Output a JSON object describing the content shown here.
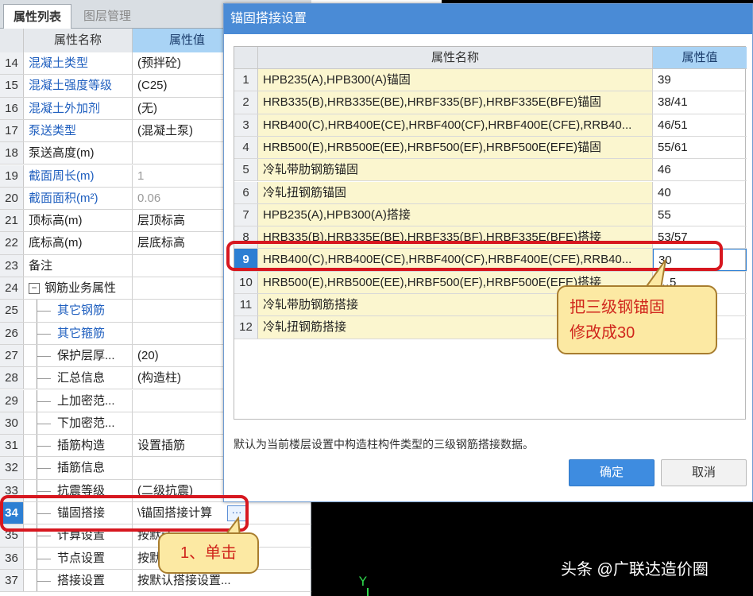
{
  "left_panel": {
    "tabs": [
      "属性列表",
      "图层管理"
    ],
    "header": {
      "name": "属性名称",
      "value": "属性值"
    },
    "rows": [
      {
        "num": "14",
        "name": "混凝土类型",
        "value": "(预拌砼)"
      },
      {
        "num": "15",
        "name": "混凝土强度等级",
        "value": "(C25)"
      },
      {
        "num": "16",
        "name": "混凝土外加剂",
        "value": "(无)"
      },
      {
        "num": "17",
        "name": "泵送类型",
        "value": "(混凝土泵)"
      },
      {
        "num": "18",
        "name": "泵送高度(m)",
        "value": ""
      },
      {
        "num": "19",
        "name": "截面周长(m)",
        "value": "1"
      },
      {
        "num": "20",
        "name": "截面面积(m²)",
        "value": "0.06"
      },
      {
        "num": "21",
        "name": "顶标高(m)",
        "value": "层顶标高"
      },
      {
        "num": "22",
        "name": "底标高(m)",
        "value": "层底标高"
      },
      {
        "num": "23",
        "name": "备注",
        "value": ""
      },
      {
        "num": "24",
        "name": "钢筋业务属性",
        "value": "",
        "collapse": "−"
      },
      {
        "num": "25",
        "name": "其它钢筋",
        "value": ""
      },
      {
        "num": "26",
        "name": "其它箍筋",
        "value": ""
      },
      {
        "num": "27",
        "name": "保护层厚...",
        "value": "(20)"
      },
      {
        "num": "28",
        "name": "汇总信息",
        "value": "(构造柱)"
      },
      {
        "num": "29",
        "name": "上加密范...",
        "value": ""
      },
      {
        "num": "30",
        "name": "下加密范...",
        "value": ""
      },
      {
        "num": "31",
        "name": "插筋构造",
        "value": "设置插筋"
      },
      {
        "num": "32",
        "name": "插筋信息",
        "value": ""
      },
      {
        "num": "33",
        "name": "抗震等级",
        "value": "(二级抗震)"
      },
      {
        "num": "34",
        "name": "锚固搭接",
        "value": "\\锚固搭接计算",
        "button": "···"
      },
      {
        "num": "35",
        "name": "计算设置",
        "value": "按默认..."
      },
      {
        "num": "36",
        "name": "节点设置",
        "value": "按默认..."
      },
      {
        "num": "37",
        "name": "搭接设置",
        "value": "按默认搭接设置..."
      }
    ]
  },
  "dialog": {
    "title": "锚固搭接设置",
    "header": {
      "name": "属性名称",
      "value": "属性值"
    },
    "rows": [
      {
        "num": "1",
        "name": "HPB235(A),HPB300(A)锚固",
        "value": "39"
      },
      {
        "num": "2",
        "name": "HRB335(B),HRB335E(BE),HRBF335(BF),HRBF335E(BFE)锚固",
        "value": "38/41"
      },
      {
        "num": "3",
        "name": "HRB400(C),HRB400E(CE),HRBF400(CF),HRBF400E(CFE),RRB40...",
        "value": "46/51"
      },
      {
        "num": "4",
        "name": "HRB500(E),HRB500E(EE),HRBF500(EF),HRBF500E(EFE)锚固",
        "value": "55/61"
      },
      {
        "num": "5",
        "name": "冷轧带肋钢筋锚固",
        "value": "46"
      },
      {
        "num": "6",
        "name": "冷轧扭钢筋锚固",
        "value": "40"
      },
      {
        "num": "7",
        "name": "HPB235(A),HPB300(A)搭接",
        "value": "55"
      },
      {
        "num": "8",
        "name": "HRB335(B),HRB335E(BE),HRBF335(BF),HRBF335E(BFE)搭接",
        "value": "53/57"
      },
      {
        "num": "9",
        "name": "HRB400(C),HRB400E(CE),HRBF400(CF),HRBF400E(CFE),RRB40...",
        "value": "30"
      },
      {
        "num": "10",
        "name": "HRB500(E),HRB500E(EE),HRBF500(EF),HRBF500E(EFE)搭接",
        "value": "…5"
      },
      {
        "num": "11",
        "name": "冷轧带肋钢筋搭接",
        "value": ""
      },
      {
        "num": "12",
        "name": "冷轧扭钢筋搭接",
        "value": ""
      }
    ],
    "note": "默认为当前楼层设置中构造柱构件类型的三级钢筋搭接数据。",
    "ok_label": "确定",
    "cancel_label": "取消"
  },
  "annotations": {
    "modify_line1": "把三级钢锚固",
    "modify_line2": "修改成30",
    "click": "1、单击"
  },
  "viewport": {
    "axis_label": "Y",
    "watermark": "头条 @广联达造价圈"
  }
}
